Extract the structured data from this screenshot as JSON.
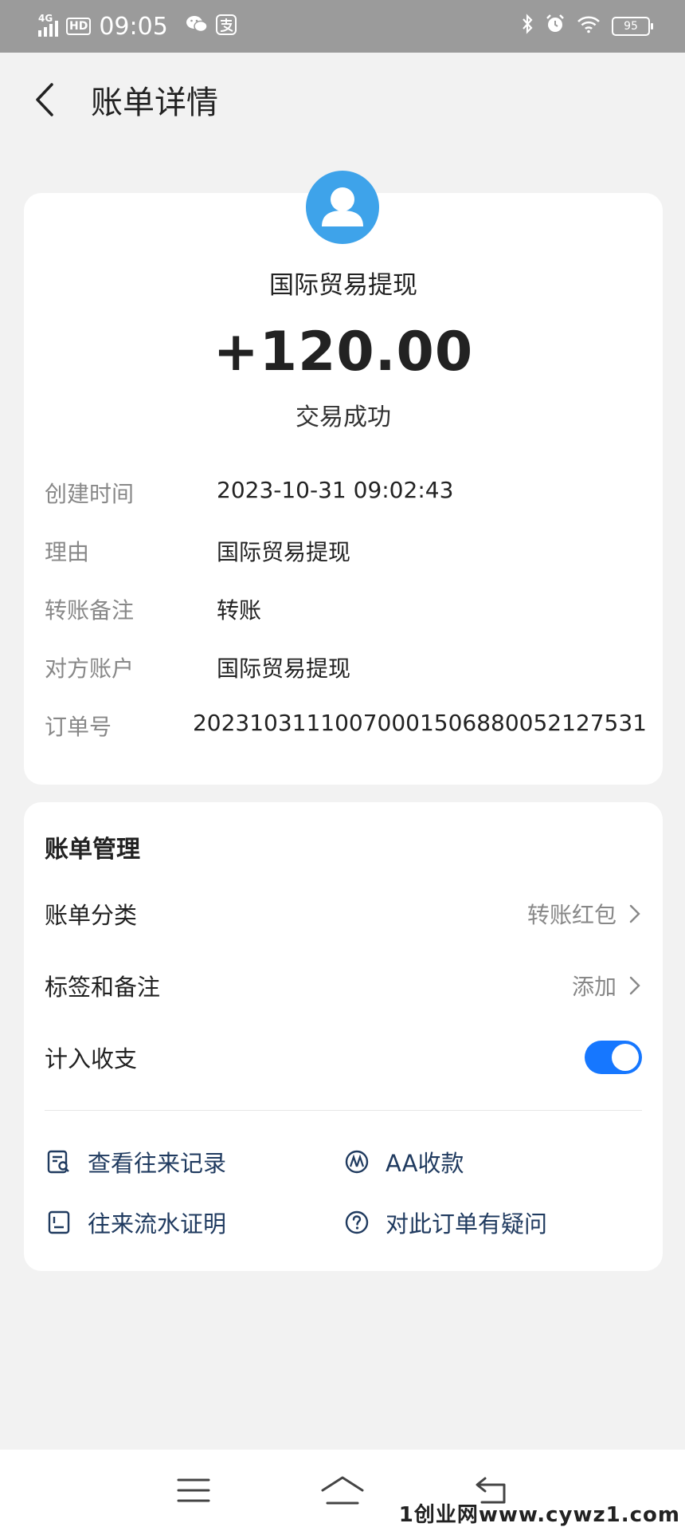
{
  "status_bar": {
    "network": "4G",
    "hd": "HD",
    "time": "09:05",
    "app_icons": [
      "wechat-icon",
      "alipay-icon"
    ],
    "right_icons": [
      "bluetooth-icon",
      "alarm-icon",
      "wifi-icon"
    ],
    "battery": "95"
  },
  "header": {
    "title": "账单详情"
  },
  "detail": {
    "payee": "国际贸易提现",
    "amount": "+120.00",
    "status": "交易成功",
    "rows": [
      {
        "label": "创建时间",
        "value": "2023-10-31 09:02:43"
      },
      {
        "label": "理由",
        "value": "国际贸易提现"
      },
      {
        "label": "转账备注",
        "value": "转账"
      },
      {
        "label": "对方账户",
        "value": "国际贸易提现"
      },
      {
        "label": "订单号",
        "value": "20231031110070001506880052127531"
      }
    ]
  },
  "manage": {
    "title": "账单管理",
    "category_label": "账单分类",
    "category_value": "转账红包",
    "tag_label": "标签和备注",
    "tag_value": "添加",
    "include_label": "计入收支",
    "include_on": true,
    "actions": [
      {
        "label": "查看往来记录",
        "icon": "records-icon"
      },
      {
        "label": "AA收款",
        "icon": "aa-icon"
      },
      {
        "label": "往来流水证明",
        "icon": "statement-icon"
      },
      {
        "label": "对此订单有疑问",
        "icon": "question-icon"
      }
    ]
  },
  "watermark": "1创业网www.cywz1.com",
  "colors": {
    "accent": "#1677ff",
    "avatar": "#3ea3ea",
    "action_text": "#1f3a5f"
  }
}
